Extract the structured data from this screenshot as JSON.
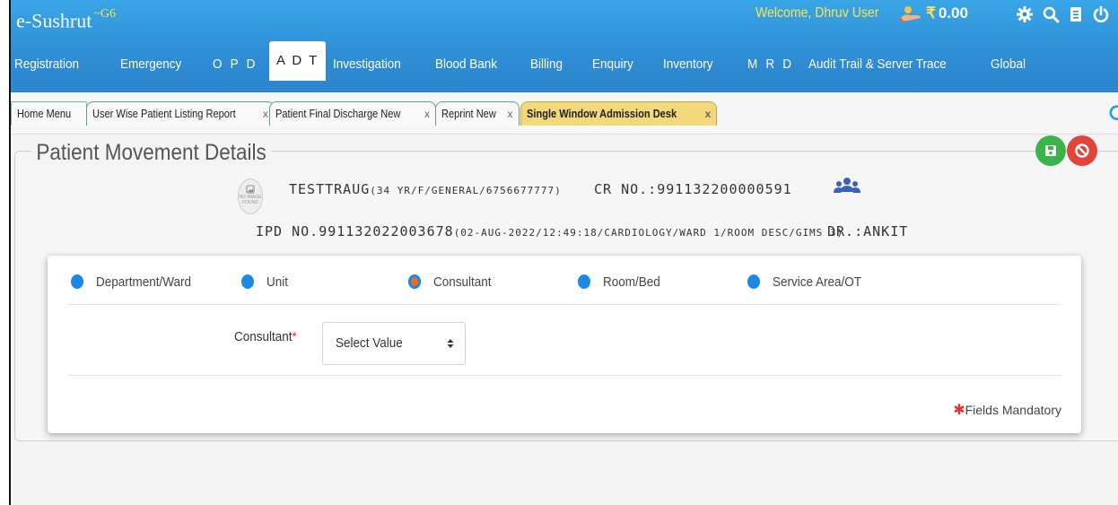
{
  "app": {
    "name": "e-Sushrut",
    "version": "~G6",
    "welcome": "Welcome, Dhruv User",
    "balance": "0.00",
    "currency_symbol": "₹"
  },
  "nav": {
    "items": [
      {
        "label": "Registration"
      },
      {
        "label": "Emergency"
      },
      {
        "label": "O P D"
      },
      {
        "label": "A D T",
        "active": true
      },
      {
        "label": "Investigation"
      },
      {
        "label": "Blood Bank"
      },
      {
        "label": "Billing"
      },
      {
        "label": "Enquiry"
      },
      {
        "label": "Inventory"
      },
      {
        "label": "M R D"
      },
      {
        "label": "Audit Trail & Server Trace"
      },
      {
        "label": "Global"
      }
    ]
  },
  "tabs": {
    "home": "Home Menu",
    "items": [
      {
        "label": "User Wise Patient Listing Report",
        "close": "x"
      },
      {
        "label": "Patient Final Discharge New",
        "close": "x"
      },
      {
        "label": "Reprint New",
        "close": "x"
      },
      {
        "label": "Single Window Admission Desk",
        "close": "x",
        "active": true
      }
    ]
  },
  "panel": {
    "title": "Patient Movement Details"
  },
  "patient": {
    "photo_text": "NO IMAGE FOUND",
    "name": "TESTTRAUG",
    "details": "(34 YR/F/GENERAL/6756677777)",
    "cr_no": "CR NO.:991132200000591",
    "ipd_no": "IPD NO.991132022003678",
    "ipd_details": "(02-AUG-2022/12:49:18/CARDIOLOGY/WARD 1/ROOM DESC/GIMS 3)",
    "doctor": "DR.:ANKIT"
  },
  "steps": [
    {
      "label": "Department/Ward"
    },
    {
      "label": "Unit"
    },
    {
      "label": "Consultant",
      "current": true
    },
    {
      "label": "Room/Bed"
    },
    {
      "label": "Service Area/OT"
    }
  ],
  "form": {
    "consultant_label": "Consultant",
    "required_mark": "*",
    "consultant_value": "Select Value",
    "mandatory_note": "Fields Mandatory",
    "mandatory_star": "✱"
  },
  "colors": {
    "header": "#2f8fd6",
    "welcome_text": "#ffe44d",
    "active_tab": "#f3d97c",
    "save_button": "#3bb44a",
    "cancel_button": "#e2443c",
    "step_dot": "#1e88e5",
    "step_current": "#f26b1d"
  }
}
